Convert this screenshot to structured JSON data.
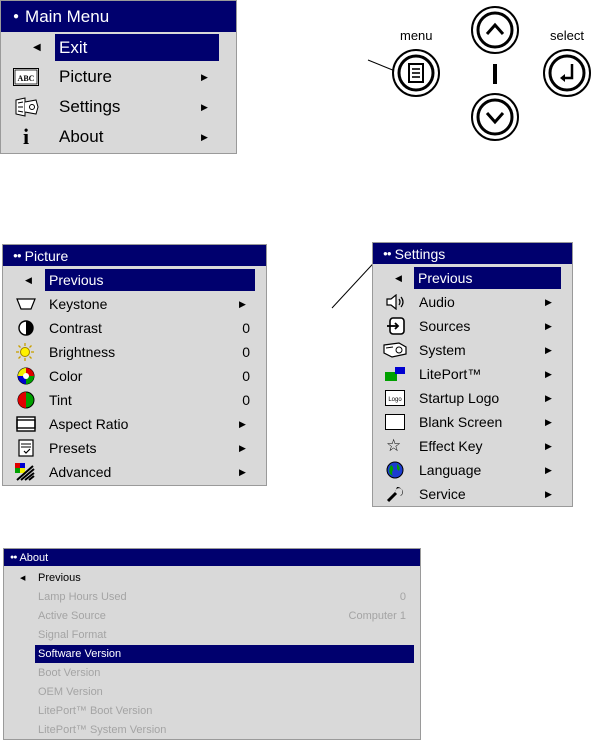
{
  "main_menu": {
    "title": "Main Menu",
    "items": [
      {
        "label": "Exit",
        "icon": "back-arrow-icon",
        "selected": true
      },
      {
        "label": "Picture",
        "icon": "abc-icon",
        "submenu": true
      },
      {
        "label": "Settings",
        "icon": "settings-projector-icon",
        "submenu": true
      },
      {
        "label": "About",
        "icon": "info-icon",
        "submenu": true
      }
    ]
  },
  "remote": {
    "menu_label": "menu",
    "select_label": "select"
  },
  "picture_menu": {
    "title": "Picture",
    "items": [
      {
        "label": "Previous",
        "icon": "back-arrow-icon",
        "selected": true
      },
      {
        "label": "Keystone",
        "icon": "keystone-icon",
        "submenu": true
      },
      {
        "label": "Contrast",
        "icon": "contrast-icon",
        "value": "0"
      },
      {
        "label": "Brightness",
        "icon": "brightness-icon",
        "value": "0"
      },
      {
        "label": "Color",
        "icon": "color-icon",
        "value": "0"
      },
      {
        "label": "Tint",
        "icon": "tint-icon",
        "value": "0"
      },
      {
        "label": "Aspect Ratio",
        "icon": "aspect-ratio-icon",
        "submenu": true
      },
      {
        "label": "Presets",
        "icon": "presets-icon",
        "submenu": true
      },
      {
        "label": "Advanced",
        "icon": "advanced-icon",
        "submenu": true
      }
    ]
  },
  "settings_menu": {
    "title": "Settings",
    "items": [
      {
        "label": "Previous",
        "icon": "back-arrow-icon",
        "selected": true
      },
      {
        "label": "Audio",
        "icon": "speaker-icon",
        "submenu": true
      },
      {
        "label": "Sources",
        "icon": "sources-icon",
        "submenu": true
      },
      {
        "label": "System",
        "icon": "system-icon",
        "submenu": true
      },
      {
        "label": "LitePort™",
        "icon": "liteport-icon",
        "submenu": true
      },
      {
        "label": "Startup Logo",
        "icon": "logo-icon",
        "submenu": true
      },
      {
        "label": "Blank Screen",
        "icon": "blank-screen-icon",
        "submenu": true
      },
      {
        "label": "Effect Key",
        "icon": "star-icon",
        "submenu": true
      },
      {
        "label": "Language",
        "icon": "globe-icon",
        "submenu": true
      },
      {
        "label": "Service",
        "icon": "wrench-icon",
        "submenu": true
      }
    ]
  },
  "about_menu": {
    "title": "About",
    "items": [
      {
        "label": "Previous",
        "value": "",
        "enabled": true,
        "selected": false
      },
      {
        "label": "Lamp Hours Used",
        "value": "0",
        "enabled": false,
        "selected": false
      },
      {
        "label": "Active Source",
        "value": "Computer 1",
        "enabled": false,
        "selected": false
      },
      {
        "label": "Signal Format",
        "value": "",
        "enabled": false,
        "selected": false
      },
      {
        "label": "Software Version",
        "value": "",
        "enabled": true,
        "selected": true
      },
      {
        "label": "Boot Version",
        "value": "",
        "enabled": false,
        "selected": false
      },
      {
        "label": "OEM Version",
        "value": "",
        "enabled": false,
        "selected": false
      },
      {
        "label": "LitePort™ Boot Version",
        "value": "",
        "enabled": false,
        "selected": false
      },
      {
        "label": "LitePort™ System Version",
        "value": "",
        "enabled": false,
        "selected": false
      }
    ]
  },
  "colors": {
    "title_bar": "#00006e",
    "panel": "#d9d9d9",
    "disabled_text": "#a4a4a4"
  }
}
